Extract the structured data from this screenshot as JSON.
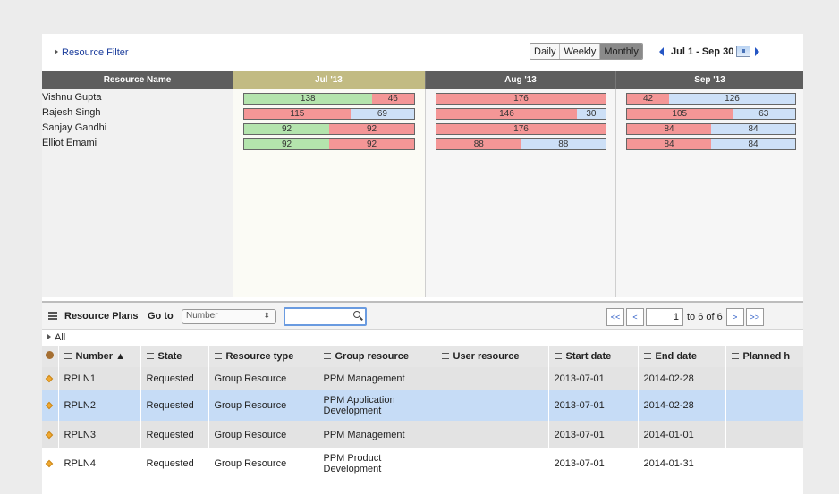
{
  "filter": {
    "resource_filter_label": "Resource Filter",
    "view_options": [
      "Daily",
      "Weekly",
      "Monthly"
    ],
    "active_view": "Monthly",
    "date_range": "Jul 1 - Sep 30"
  },
  "timeline": {
    "headers": {
      "resource_name": "Resource Name",
      "months": [
        "Jul '13",
        "Aug '13",
        "Sep '13"
      ]
    },
    "rows": [
      {
        "name": "Vishnu Gupta",
        "jul": [
          {
            "v": "138",
            "c": "g",
            "f": 0.75
          },
          {
            "v": "46",
            "c": "r",
            "f": 0.25
          }
        ],
        "aug": [
          {
            "v": "176",
            "c": "r",
            "f": 1
          }
        ],
        "sep": [
          {
            "v": "42",
            "c": "r",
            "f": 0.25
          },
          {
            "v": "126",
            "c": "b",
            "f": 0.75
          }
        ]
      },
      {
        "name": "Rajesh Singh",
        "jul": [
          {
            "v": "115",
            "c": "r",
            "f": 0.625
          },
          {
            "v": "69",
            "c": "b",
            "f": 0.375
          }
        ],
        "aug": [
          {
            "v": "146",
            "c": "r",
            "f": 0.83
          },
          {
            "v": "30",
            "c": "b",
            "f": 0.17
          }
        ],
        "sep": [
          {
            "v": "105",
            "c": "r",
            "f": 0.625
          },
          {
            "v": "63",
            "c": "b",
            "f": 0.375
          }
        ]
      },
      {
        "name": "Sanjay Gandhi",
        "jul": [
          {
            "v": "92",
            "c": "g",
            "f": 0.5
          },
          {
            "v": "92",
            "c": "r",
            "f": 0.5
          }
        ],
        "aug": [
          {
            "v": "176",
            "c": "r",
            "f": 1
          }
        ],
        "sep": [
          {
            "v": "84",
            "c": "r",
            "f": 0.5
          },
          {
            "v": "84",
            "c": "b",
            "f": 0.5
          }
        ]
      },
      {
        "name": "Elliot Emami",
        "jul": [
          {
            "v": "92",
            "c": "g",
            "f": 0.5
          },
          {
            "v": "92",
            "c": "r",
            "f": 0.5
          }
        ],
        "aug": [
          {
            "v": "88",
            "c": "r",
            "f": 0.5
          },
          {
            "v": "88",
            "c": "b",
            "f": 0.5
          }
        ],
        "sep": [
          {
            "v": "84",
            "c": "r",
            "f": 0.5
          },
          {
            "v": "84",
            "c": "b",
            "f": 0.5
          }
        ]
      }
    ]
  },
  "plans": {
    "title": "Resource Plans",
    "goto_label": "Go to",
    "goto_select": "Number",
    "search_value": "",
    "pager": {
      "first": "<<",
      "prev": "<",
      "page": "1",
      "of_text": "to 6 of 6",
      "next": ">",
      "last": ">>"
    },
    "all_label": "All",
    "columns": [
      "Number ▲",
      "State",
      "Resource type",
      "Group resource",
      "User resource",
      "Start date",
      "End date",
      "Planned h"
    ],
    "rows": [
      {
        "number": "RPLN1",
        "state": "Requested",
        "type": "Group Resource",
        "group": "PPM Management",
        "user": "",
        "start": "2013-07-01",
        "end": "2014-02-28",
        "planned": "",
        "style": "gray"
      },
      {
        "number": "RPLN2",
        "state": "Requested",
        "type": "Group Resource",
        "group": "PPM Application Development",
        "user": "",
        "start": "2013-07-01",
        "end": "2014-02-28",
        "planned": "",
        "style": "sel"
      },
      {
        "number": "RPLN3",
        "state": "Requested",
        "type": "Group Resource",
        "group": "PPM Management",
        "user": "",
        "start": "2013-07-01",
        "end": "2014-01-01",
        "planned": "",
        "style": "gray"
      },
      {
        "number": "RPLN4",
        "state": "Requested",
        "type": "Group Resource",
        "group": "PPM Product Development",
        "user": "",
        "start": "2013-07-01",
        "end": "2014-01-31",
        "planned": "",
        "style": "white"
      }
    ]
  }
}
